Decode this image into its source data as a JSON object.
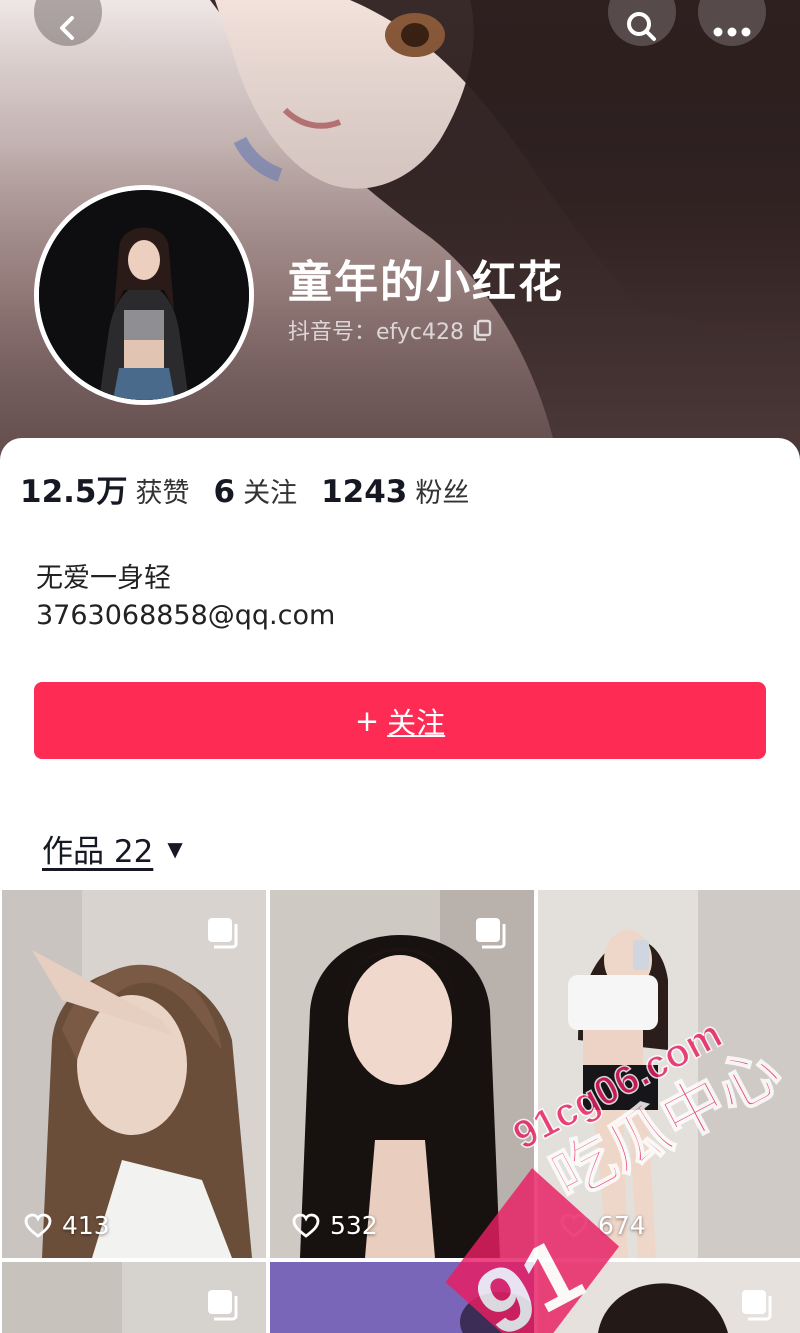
{
  "header": {
    "nickname": "童年的小红花",
    "douyin_id_label": "抖音号：efyc428",
    "icons": [
      "back-icon",
      "search-icon",
      "more-icon",
      "copy-icon"
    ]
  },
  "stats": [
    {
      "value": "12.5万",
      "label": "获赞"
    },
    {
      "value": "6",
      "label": "关注"
    },
    {
      "value": "1243",
      "label": "粉丝"
    }
  ],
  "profile": {
    "bio": "无爱一身轻",
    "email": "3763068858@qq.com"
  },
  "follow_button": {
    "plus": "+",
    "label": "关注",
    "color": "#fe2c55"
  },
  "works_tab": {
    "label": "作品 22",
    "arrow": "▼"
  },
  "videos": [
    {
      "likes": "413"
    },
    {
      "likes": "532"
    },
    {
      "likes": "674"
    },
    {
      "likes": ""
    },
    {
      "likes": ""
    },
    {
      "likes": ""
    }
  ],
  "watermark": {
    "number": "91",
    "domain": "91cg06.com",
    "name": "吃瓜中心",
    "color": "#e91e63"
  }
}
